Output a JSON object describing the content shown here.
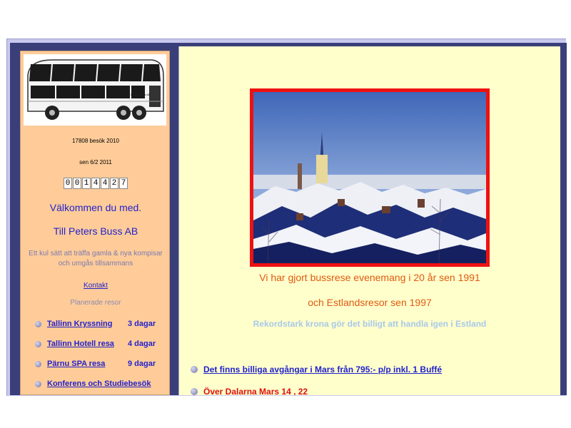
{
  "sidebar": {
    "bus_image_label": "Peters Buss AB",
    "visits_text": "17808 besök 2010",
    "since_text": "sen 6/2 2011",
    "counter_digits": [
      "0",
      "0",
      "1",
      "4",
      "4",
      "2",
      "7"
    ],
    "welcome_line1": "Välkommen du med.",
    "welcome_line2": "Till Peters Buss AB",
    "tagline": "Ett kul sätt att träffa  gamla & nya kompisar och umgås tillsammans",
    "contact_link": "Kontakt",
    "planned_label": "Planerade resor",
    "trips": [
      {
        "name": "Tallinn  Kryssning",
        "days": "3 dagar"
      },
      {
        "name": "Tallinn Hotell resa",
        "days": "4 dagar"
      },
      {
        "name": "Pärnu  SPA resa",
        "days": "9 dagar"
      },
      {
        "name": "Konferens och Studiebesök",
        "days": ""
      }
    ]
  },
  "main": {
    "line1": "Vi har gjort bussrese evenemang i 20 år sen 1991",
    "line2": "och Estlandsresor sen 1997",
    "line3": "Rekordstark krona gör det billigt att handla igen i Estland",
    "offers": [
      {
        "text": "Det finns billiga avgångar  i  Mars från 795:- p/p  inkl. 1 Buffé",
        "color": "#2222cc",
        "underline": true
      },
      {
        "text": "Över Dalarna    Mars  14 , 22",
        "color": "#dd1111",
        "underline": false
      }
    ]
  },
  "colors": {
    "sidebar_bg": "#ffcc99",
    "main_bg": "#ffffcc",
    "link_blue": "#2222cc",
    "orange_text": "#e05a10",
    "photo_frame_red": "#ee1111"
  }
}
